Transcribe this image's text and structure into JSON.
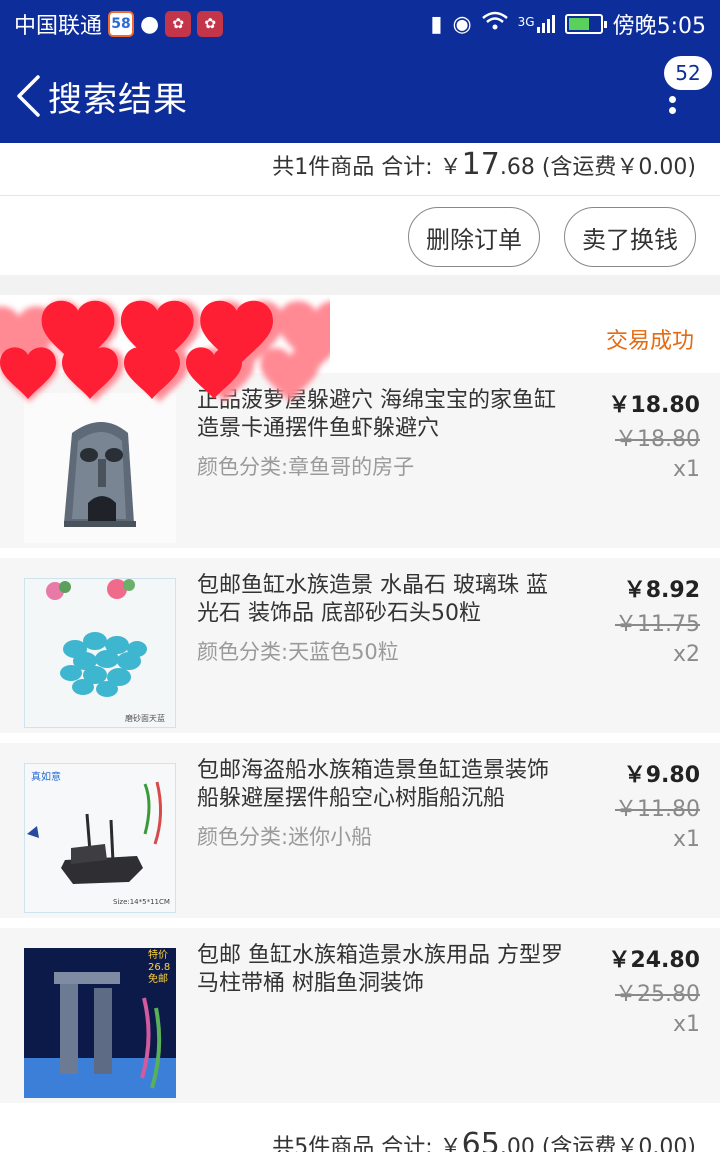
{
  "status_bar": {
    "carrier": "中国联通",
    "app_badge_58": "58",
    "network": "3G",
    "time": "傍晚5:05"
  },
  "nav": {
    "title": "搜索结果",
    "badge_count": "52"
  },
  "top_order": {
    "summary_prefix": "共1件商品  合计: ￥",
    "summary_big": "17",
    "summary_suffix": ".68 (含运费￥0.00)",
    "buttons": {
      "delete": "删除订单",
      "sell": "卖了换钱"
    }
  },
  "order": {
    "status": "交易成功",
    "items": [
      {
        "title": "正品菠萝屋躲避穴 海绵宝宝的家鱼缸造景卡通摆件鱼虾躲避穴",
        "spec": "颜色分类:章鱼哥的房子",
        "price": "￥18.80",
        "orig_price": "￥18.80",
        "qty": "x1"
      },
      {
        "title": "包邮鱼缸水族造景 水晶石 玻璃珠 蓝光石 装饰品  底部砂石头50粒",
        "spec": "颜色分类:天蓝色50粒",
        "price": "￥8.92",
        "orig_price": "￥11.75",
        "qty": "x2",
        "thumb_caption": "磨砂面天蓝"
      },
      {
        "title": "包邮海盗船水族箱造景鱼缸造景装饰船躲避屋摆件船空心树脂船沉船",
        "spec": "颜色分类:迷你小船",
        "price": "￥9.80",
        "orig_price": "￥11.80",
        "qty": "x1",
        "thumb_caption": "Size:14*5*11CM",
        "thumb_brand": "真如意"
      },
      {
        "title": "包邮 鱼缸水族箱造景水族用品 方型罗马柱带桶 树脂鱼洞装饰",
        "spec": "",
        "price": "￥24.80",
        "orig_price": "￥25.80",
        "qty": "x1",
        "thumb_tag": [
          "特价",
          "26.8",
          "免邮"
        ]
      }
    ],
    "summary_prefix": "共5件商品  合计: ￥",
    "summary_big": "65",
    "summary_suffix": ".00 (含运费￥0.00)"
  },
  "colors": {
    "header_bg": "#0d2d9a",
    "status_accent": "#e56a10",
    "heart_red": "#ff2d3a"
  }
}
